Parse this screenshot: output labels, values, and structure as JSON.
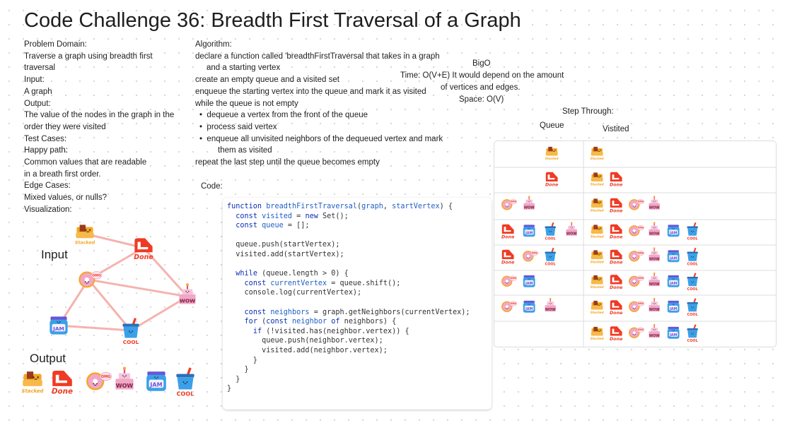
{
  "title": "Code Challenge 36: Breadth First Traversal of a Graph",
  "left_notes": [
    "Problem Domain:",
    "Traverse a graph using breadth first",
    "traversal",
    "Input:",
    "A graph",
    "Output:",
    "The value of the nodes in the graph in the",
    "order they were visited",
    "Test Cases:",
    "Happy path:",
    "Common values that are readable",
    "in a breath first order.",
    "Edge Cases:",
    "Mixed values, or nulls?",
    "Visualization:"
  ],
  "algorithm": {
    "heading": "Algorithm:",
    "line1": "declare a function called 'breadthFirstTraversal that takes in a graph",
    "line1b": "and a starting vertex",
    "line2": "create an empty queue and a visited set",
    "line3": "enqueue the starting vertex into the queue and mark it as visited",
    "line4": "while the queue is not empty",
    "bullet1": "dequeue a vertex from the front of the queue",
    "bullet2": "process said vertex",
    "bullet3": "enqueue all unvisited neighbors of the dequeued vertex and mark",
    "bullet3b": "them as visited",
    "line5": "repeat the last step until the queue becomes empty"
  },
  "bigo": {
    "heading": "BigO",
    "time": "Time: O(V+E) It would depend on the amount",
    "time2": "of vertices and edges.",
    "space": "Space: O(V)"
  },
  "step_through": {
    "heading": "Step Through:",
    "queue_label": "Queue",
    "visited_label": "Vistited"
  },
  "code_label": "Code:",
  "code_lines": [
    "function breadthFirstTraversal(graph, startVertex) {",
    "  const visited = new Set();",
    "  const queue = [];",
    "",
    "  queue.push(startVertex);",
    "  visited.add(startVertex);",
    "",
    "  while (queue.length > 0) {",
    "    const currentVertex = queue.shift();",
    "    console.log(currentVertex);",
    "",
    "    const neighbors = graph.getNeighbors(currentVertex);",
    "    for (const neighbor of neighbors) {",
    "      if (!visited.has(neighbor.vertex)) {",
    "        queue.push(neighbor.vertex);",
    "        visited.add(neighbor.vertex);",
    "      }",
    "    }",
    "  }",
    "}"
  ],
  "graph": {
    "input_label": "Input",
    "output_label": "Output",
    "nodes": {
      "stacked": "Stacked",
      "done": "Done",
      "omg": "OMG",
      "wow": "WOW",
      "jam": "JAM",
      "cool": "COOL"
    },
    "edges": [
      [
        "stacked",
        "done"
      ],
      [
        "done",
        "omg"
      ],
      [
        "done",
        "wow"
      ],
      [
        "omg",
        "wow"
      ],
      [
        "omg",
        "jam"
      ],
      [
        "omg",
        "cool"
      ],
      [
        "wow",
        "cool"
      ],
      [
        "jam",
        "cool"
      ]
    ]
  },
  "steps": [
    {
      "queue": [
        "stacked"
      ],
      "visited": [
        "stacked"
      ]
    },
    {
      "queue": [
        "done"
      ],
      "visited": [
        "stacked",
        "done"
      ]
    },
    {
      "queue": [
        "omg",
        "wow"
      ],
      "visited": [
        "stacked",
        "done",
        "omg",
        "wow"
      ]
    },
    {
      "queue": [
        "done",
        "jam",
        "cool",
        "wow"
      ],
      "visited": [
        "stacked",
        "done",
        "omg",
        "wow",
        "jam",
        "cool"
      ]
    },
    {
      "queue": [
        "done",
        "omg",
        "cool"
      ],
      "visited": [
        "stacked",
        "done",
        "omg",
        "wow",
        "jam",
        "cool"
      ]
    },
    {
      "queue": [
        "omg",
        "jam"
      ],
      "visited": [
        "stacked",
        "done",
        "omg",
        "wow",
        "jam",
        "cool"
      ]
    },
    {
      "queue": [
        "omg",
        "jam",
        "wow"
      ],
      "visited": [
        "stacked",
        "done",
        "omg",
        "wow",
        "jam",
        "cool"
      ]
    },
    {
      "queue": [],
      "visited": [
        "stacked",
        "done",
        "omg",
        "wow",
        "jam",
        "cool"
      ]
    }
  ],
  "output_order": [
    "stacked",
    "done",
    "omg",
    "wow",
    "jam",
    "cool"
  ],
  "colors": {
    "edge": "#f5b3ae",
    "orange": "#f5a623",
    "red": "#ef3b24",
    "pink": "#f2a7c6",
    "blue": "#3aa0e8",
    "purple": "#6a55d8",
    "keyword": "#0b2fb3"
  }
}
